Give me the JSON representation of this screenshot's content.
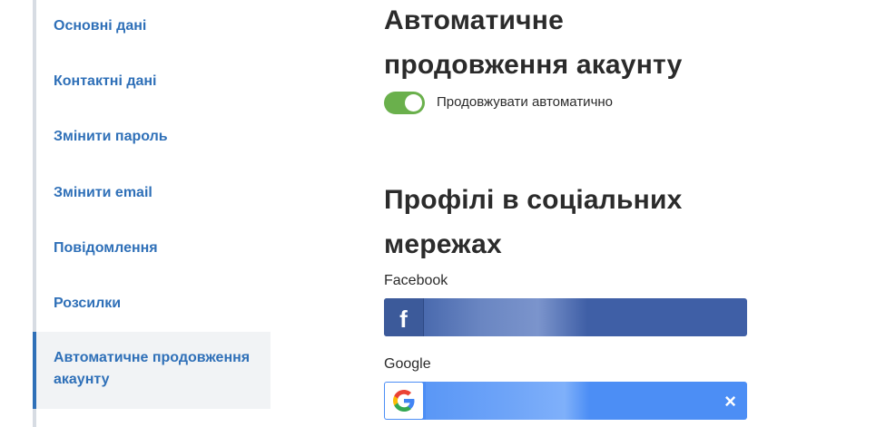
{
  "sidebar": {
    "items": [
      {
        "label": "Основні дані"
      },
      {
        "label": "Контактні дані"
      },
      {
        "label": "Змінити пароль"
      },
      {
        "label": "Змінити email"
      },
      {
        "label": "Повідомлення"
      },
      {
        "label": "Розсилки"
      },
      {
        "label": "Автоматичне продовження акаунту",
        "active": true
      }
    ]
  },
  "auto_renew": {
    "title": "Автоматичне продовження акаунту",
    "toggle_on": true,
    "toggle_label": "Продовжувати автоматично"
  },
  "social": {
    "title": "Профілі в соціальних мережах",
    "facebook": {
      "label": "Facebook",
      "icon": "facebook-icon",
      "color": "#3f5fa6"
    },
    "google": {
      "label": "Google",
      "icon": "google-icon",
      "color": "#4c8ef5",
      "remove_symbol": "×"
    }
  }
}
